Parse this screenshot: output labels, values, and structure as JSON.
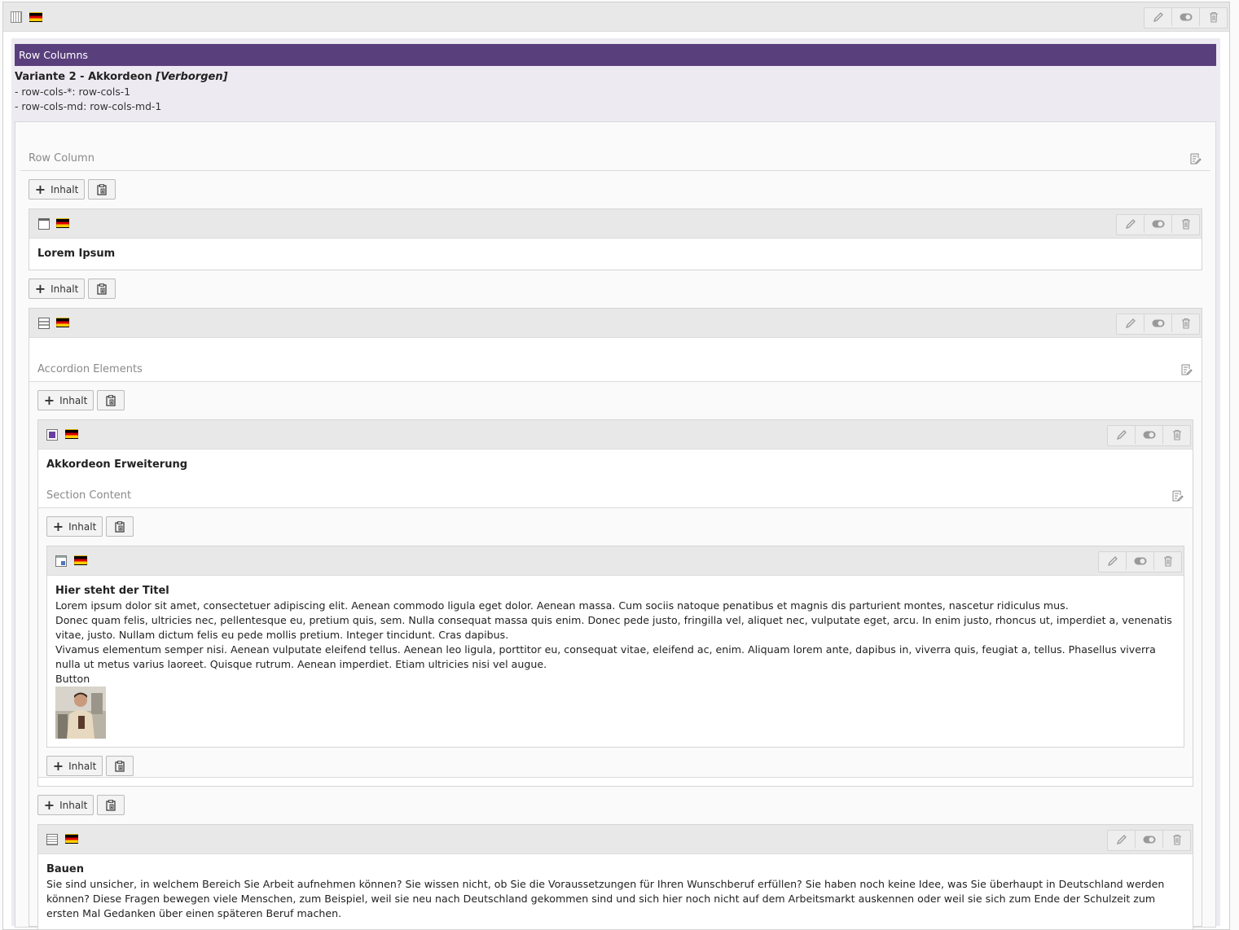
{
  "colors": {
    "purple_header": "#5a3f7d",
    "purple_bg": "#edeaf2",
    "header_bg": "#e8e8e8"
  },
  "icons": {
    "edit": "pencil-icon",
    "toggle": "toggle-icon",
    "delete": "trash-icon",
    "flag": "german-flag-icon",
    "paste": "clipboard-icon",
    "note": "edit-note-icon"
  },
  "root": {
    "banner": "Row Columns",
    "variant_title": "Variante 2 - Akkordeon",
    "hidden_tag": "[Verborgen]",
    "meta_line1": "- row-cols-*: row-cols-1",
    "meta_line2": "- row-cols-md: row-cols-md-1"
  },
  "row_column": {
    "label": "Row Column"
  },
  "add_button_label": "Inhalt",
  "lorem_element": {
    "title": "Lorem Ipsum"
  },
  "accordion_container": {
    "label": "Accordion Elements"
  },
  "accordion_item": {
    "title": "Akkordeon Erweiterung",
    "section_label": "Section Content"
  },
  "text_element": {
    "title": "Hier steht der Titel",
    "line1": "Lorem ipsum dolor sit amet, consectetuer adipiscing elit. Aenean commodo ligula eget dolor. Aenean massa. Cum sociis natoque penatibus et magnis dis parturient montes, nascetur ridiculus mus.",
    "line2": "Donec quam felis, ultricies nec, pellentesque eu, pretium quis, sem. Nulla consequat massa quis enim. Donec pede justo, fringilla vel, aliquet nec, vulputate eget, arcu. In enim justo, rhoncus ut, imperdiet a, venenatis vitae, justo. Nullam dictum felis eu pede mollis pretium. Integer tincidunt. Cras dapibus.",
    "line3": "Vivamus elementum semper nisi. Aenean vulputate eleifend tellus. Aenean leo ligula, porttitor eu, consequat vitae, eleifend ac, enim. Aliquam lorem ante, dapibus in, viverra quis, feugiat a, tellus. Phasellus viverra nulla ut metus varius laoreet. Quisque rutrum. Aenean imperdiet. Etiam ultricies nisi vel augue.",
    "button_text": "Button"
  },
  "bauen_element": {
    "title": "Bauen",
    "text": "Sie sind unsicher, in welchem Bereich Sie Arbeit aufnehmen können? Sie wissen nicht, ob Sie die Voraussetzungen für Ihren Wunschberuf erfüllen? Sie haben noch keine Idee, was Sie überhaupt in Deutschland werden können? Diese Fragen bewegen viele Menschen, zum Beispiel, weil sie neu nach Deutschland gekommen sind und sich hier noch nicht auf dem Arbeitsmarkt auskennen oder weil sie sich zum Ende der Schulzeit zum ersten Mal Gedanken über einen späteren Beruf machen."
  }
}
